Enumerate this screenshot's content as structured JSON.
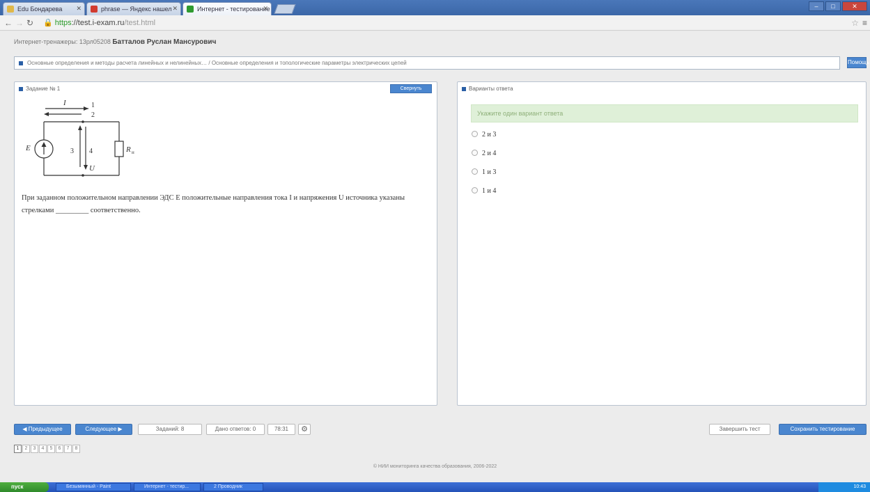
{
  "browser": {
    "tabs": [
      {
        "label": "Edu Бондарева",
        "fav_color": "#e0b84a"
      },
      {
        "label": "phrase — Яндекс нашел",
        "fav_color": "#d13b2f"
      },
      {
        "label": "Интернет - тестирование",
        "fav_color": "#2f9a2f"
      }
    ],
    "url_scheme": "https",
    "url_host": "://test.i-exam.ru",
    "url_path": "/test.html",
    "window_buttons": {
      "minimize": "–",
      "maximize": "□",
      "close": "✕"
    }
  },
  "header": {
    "user_prefix": "Интернет-тренажеры: 13рл05208",
    "user_name": "Батталов Руслан Мансурович"
  },
  "topic": {
    "text": "Основные определения и методы расчета линейных и нелинейных… / Основные определения и топологические параметры электрических цепей",
    "help_label": "Помощь"
  },
  "task": {
    "title": "Задание № 1",
    "minimize_label": "Свернуть",
    "question": "При заданном положительном направлении ЭДС E положительные направления тока I и напряжения U источника указаны стрелками _________ соответственно.",
    "circuit": {
      "I": "I",
      "one": "1",
      "two": "2",
      "three": "3",
      "four": "4",
      "E": "E",
      "U": "U",
      "R": "R",
      "R_sub": "н"
    }
  },
  "answer": {
    "title": "Варианты ответа",
    "hint": "Укажите один вариант ответа",
    "options": [
      "2 и 3",
      "2 и 4",
      "1 и 3",
      "1 и 4"
    ]
  },
  "bottom": {
    "prev_label": "◀ Предыдущее",
    "next_label": "Следующее ▶",
    "tasks_label": "Заданий: 8",
    "unanswered_label": "Дано ответов: 0",
    "timer": "78:31",
    "gear_icon": "gear-icon",
    "finish_label": "Завершить тест",
    "save_label": "Сохранить тестирование",
    "pages": [
      "1",
      "2",
      "3",
      "4",
      "5",
      "6",
      "7",
      "8"
    ]
  },
  "footer": {
    "text": "© НИИ мониторинга качества образования, 2006-2022"
  },
  "taskbar": {
    "start_label": "пуск",
    "items": [
      "Безымянный - Paint",
      "Интернет - тестир...",
      "2 Проводник"
    ],
    "clock": "10:43"
  }
}
